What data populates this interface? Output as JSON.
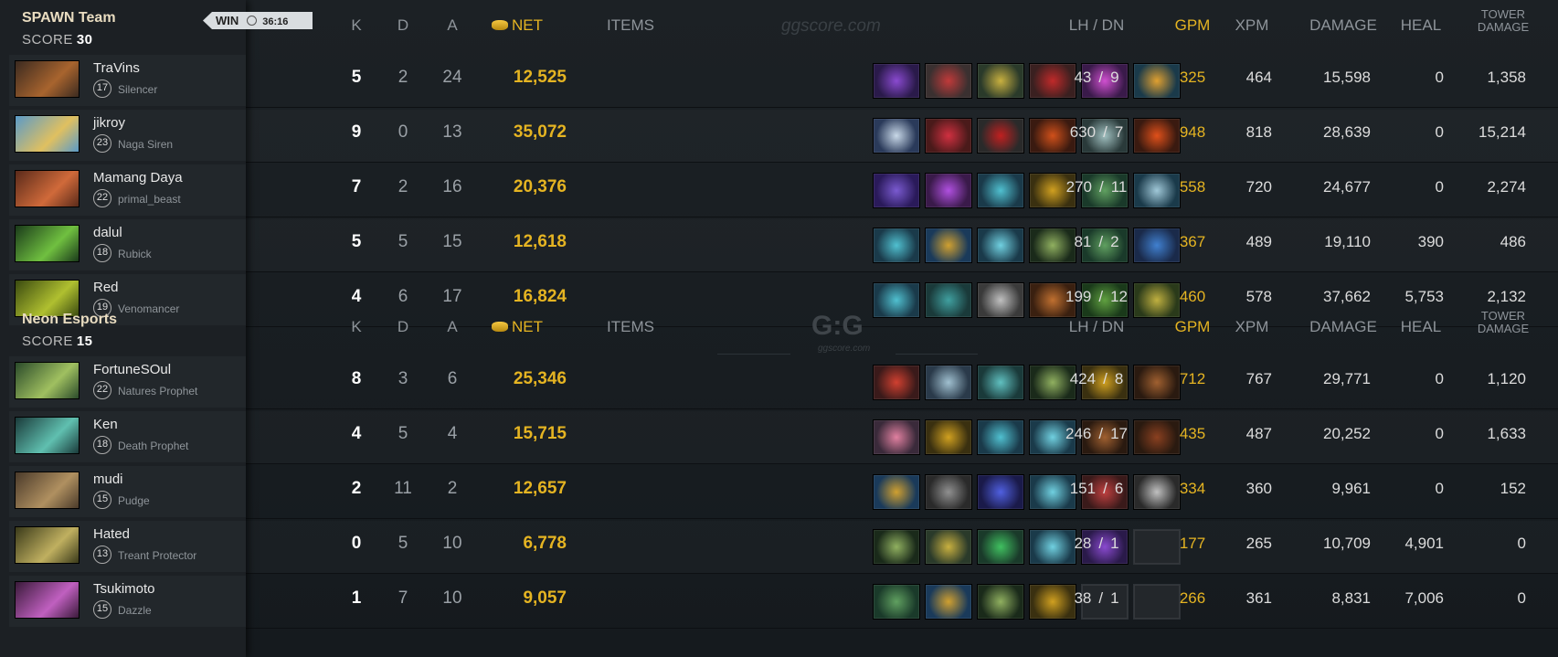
{
  "match": {
    "result": "WIN",
    "duration": "36:16",
    "watermark": "ggscore.com",
    "watermark_logo": "G:G"
  },
  "headers": {
    "k": "K",
    "d": "D",
    "a": "A",
    "net": "NET",
    "items": "ITEMS",
    "lhdn": "LH  /  DN",
    "gpm": "GPM",
    "xpm": "XPM",
    "damage": "DAMAGE",
    "heal": "HEAL",
    "tower1": "TOWER",
    "tower2": "DAMAGE"
  },
  "colors": {
    "gold": "#e5b422",
    "background": "#171b1f",
    "panel": "#1c2024",
    "team_name": "#e9dcc0"
  },
  "teams": [
    {
      "name": "SPAWN Team",
      "score_label": "SCORE",
      "score": "30",
      "players": [
        {
          "name": "TraVins",
          "level": "17",
          "hero": "Silencer",
          "k": "5",
          "d": "2",
          "a": "24",
          "net": "12,525",
          "lh": "43",
          "dn": "9",
          "gpm": "325",
          "xpm": "464",
          "damage": "15,598",
          "heal": "0",
          "tower": "1,358",
          "portrait": [
            "#3b2a20",
            "#a8642e"
          ],
          "items": [
            [
              "#2a1a4a",
              "#8a4ad0"
            ],
            [
              "#3a3030",
              "#c03a3a"
            ],
            [
              "#2a3a2a",
              "#c8b040"
            ],
            [
              "#3a2020",
              "#c02a2a"
            ],
            [
              "#3a1a4a",
              "#d050d0"
            ],
            [
              "#1a3a4a",
              "#e0a030"
            ]
          ]
        },
        {
          "name": "jikroy",
          "level": "23",
          "hero": "Naga Siren",
          "k": "9",
          "d": "0",
          "a": "13",
          "net": "35,072",
          "lh": "630",
          "dn": "7",
          "gpm": "948",
          "xpm": "818",
          "damage": "28,639",
          "heal": "0",
          "tower": "15,214",
          "portrait": [
            "#5a9ac8",
            "#e0c060"
          ],
          "items": [
            [
              "#2a3a5a",
              "#c8d8e8"
            ],
            [
              "#4a1a1a",
              "#d03040"
            ],
            [
              "#2a2a2a",
              "#c02020"
            ],
            [
              "#3a1a10",
              "#d0501a"
            ],
            [
              "#2a3a3a",
              "#a0c0c0"
            ],
            [
              "#3a1a10",
              "#e0501a"
            ]
          ]
        },
        {
          "name": "Mamang Daya",
          "level": "22",
          "hero": "primal_beast",
          "k": "7",
          "d": "2",
          "a": "16",
          "net": "20,376",
          "lh": "270",
          "dn": "11",
          "gpm": "558",
          "xpm": "720",
          "damage": "24,677",
          "heal": "0",
          "tower": "2,274",
          "portrait": [
            "#5a2a1a",
            "#d06a3a"
          ],
          "items": [
            [
              "#2a1a5a",
              "#7a5ad0"
            ],
            [
              "#3a1a4a",
              "#b050e0"
            ],
            [
              "#1a3a4a",
              "#50c0d0"
            ],
            [
              "#3a3010",
              "#d0a020"
            ],
            [
              "#1a3a2a",
              "#60a060"
            ],
            [
              "#1a3a4a",
              "#a0c8d8"
            ]
          ]
        },
        {
          "name": "dalul",
          "level": "18",
          "hero": "Rubick",
          "k": "5",
          "d": "5",
          "a": "15",
          "net": "12,618",
          "lh": "81",
          "dn": "2",
          "gpm": "367",
          "xpm": "489",
          "damage": "19,110",
          "heal": "390",
          "tower": "486",
          "portrait": [
            "#1a3a1a",
            "#70c040"
          ],
          "items": [
            [
              "#1a3a4a",
              "#50c0d0"
            ],
            [
              "#1a3a5a",
              "#d0a030"
            ],
            [
              "#1a3a4a",
              "#70d0e0"
            ],
            [
              "#1a2a1a",
              "#90b060"
            ],
            [
              "#1a3a2a",
              "#60a060"
            ],
            [
              "#1a2a4a",
              "#4080d0"
            ]
          ]
        },
        {
          "name": "Red",
          "level": "19",
          "hero": "Venomancer",
          "k": "4",
          "d": "6",
          "a": "17",
          "net": "16,824",
          "lh": "199",
          "dn": "12",
          "gpm": "460",
          "xpm": "578",
          "damage": "37,662",
          "heal": "5,753",
          "tower": "2,132",
          "portrait": [
            "#3a4a10",
            "#b0c030"
          ],
          "items": [
            [
              "#1a3a4a",
              "#50c0d0"
            ],
            [
              "#1a3a3a",
              "#40a0a0"
            ],
            [
              "#3a3a3a",
              "#c0c0c0"
            ],
            [
              "#3a2010",
              "#c07030"
            ],
            [
              "#1a3a1a",
              "#60a040"
            ],
            [
              "#2a3a1a",
              "#c0b040"
            ]
          ]
        }
      ]
    },
    {
      "name": "Neon Esports",
      "score_label": "SCORE",
      "score": "15",
      "players": [
        {
          "name": "FortuneSOul",
          "level": "22",
          "hero": "Natures Prophet",
          "k": "8",
          "d": "3",
          "a": "6",
          "net": "25,346",
          "lh": "424",
          "dn": "8",
          "gpm": "712",
          "xpm": "767",
          "damage": "29,771",
          "heal": "0",
          "tower": "1,120",
          "portrait": [
            "#2a4a2a",
            "#a0c060"
          ],
          "items": [
            [
              "#3a1a1a",
              "#d04030"
            ],
            [
              "#2a3a4a",
              "#a0c0d0"
            ],
            [
              "#1a3a3a",
              "#60c0c0"
            ],
            [
              "#1a2a1a",
              "#90b060"
            ],
            [
              "#3a3010",
              "#d0a020"
            ],
            [
              "#2a1a10",
              "#a06030"
            ]
          ]
        },
        {
          "name": "Ken",
          "level": "18",
          "hero": "Death Prophet",
          "k": "4",
          "d": "5",
          "a": "4",
          "net": "15,715",
          "lh": "246",
          "dn": "17",
          "gpm": "435",
          "xpm": "487",
          "damage": "20,252",
          "heal": "0",
          "tower": "1,633",
          "portrait": [
            "#1a3a3a",
            "#60c0b0"
          ],
          "items": [
            [
              "#3a2a3a",
              "#e080a0"
            ],
            [
              "#3a3010",
              "#d0a020"
            ],
            [
              "#1a3a4a",
              "#50c0d0"
            ],
            [
              "#1a3a4a",
              "#70d0e0"
            ],
            [
              "#2a1a10",
              "#a06030"
            ],
            [
              "#2a1a10",
              "#8a4020"
            ]
          ]
        },
        {
          "name": "mudi",
          "level": "15",
          "hero": "Pudge",
          "k": "2",
          "d": "11",
          "a": "2",
          "net": "12,657",
          "lh": "151",
          "dn": "6",
          "gpm": "334",
          "xpm": "360",
          "damage": "9,961",
          "heal": "0",
          "tower": "152",
          "portrait": [
            "#4a3a2a",
            "#b09060"
          ],
          "items": [
            [
              "#1a3a5a",
              "#d0a030"
            ],
            [
              "#2a2a2a",
              "#909090"
            ],
            [
              "#1a1a4a",
              "#5060e0"
            ],
            [
              "#1a3a4a",
              "#70d0e0"
            ],
            [
              "#3a1a1a",
              "#c04040"
            ],
            [
              "#2a2a2a",
              "#c0c0c0"
            ]
          ]
        },
        {
          "name": "Hated",
          "level": "13",
          "hero": "Treant Protector",
          "k": "0",
          "d": "5",
          "a": "10",
          "net": "6,778",
          "lh": "28",
          "dn": "1",
          "gpm": "177",
          "xpm": "265",
          "damage": "10,709",
          "heal": "4,901",
          "tower": "0",
          "portrait": [
            "#3a3a1a",
            "#c0b060"
          ],
          "items": [
            [
              "#1a2a1a",
              "#90b060"
            ],
            [
              "#2a3a2a",
              "#c8b040"
            ],
            [
              "#1a3a2a",
              "#40c060"
            ],
            [
              "#1a3a4a",
              "#70d0e0"
            ],
            [
              "#2a1a4a",
              "#8a4ad0"
            ],
            null
          ]
        },
        {
          "name": "Tsukimoto",
          "level": "15",
          "hero": "Dazzle",
          "k": "1",
          "d": "7",
          "a": "10",
          "net": "9,057",
          "lh": "38",
          "dn": "1",
          "gpm": "266",
          "xpm": "361",
          "damage": "8,831",
          "heal": "7,006",
          "tower": "0",
          "portrait": [
            "#3a1a3a",
            "#c060c0"
          ],
          "items": [
            [
              "#1a3a2a",
              "#60a060"
            ],
            [
              "#1a3a5a",
              "#d0a030"
            ],
            [
              "#1a2a1a",
              "#90b060"
            ],
            [
              "#3a3010",
              "#d0a020"
            ],
            null,
            null
          ]
        }
      ]
    }
  ]
}
